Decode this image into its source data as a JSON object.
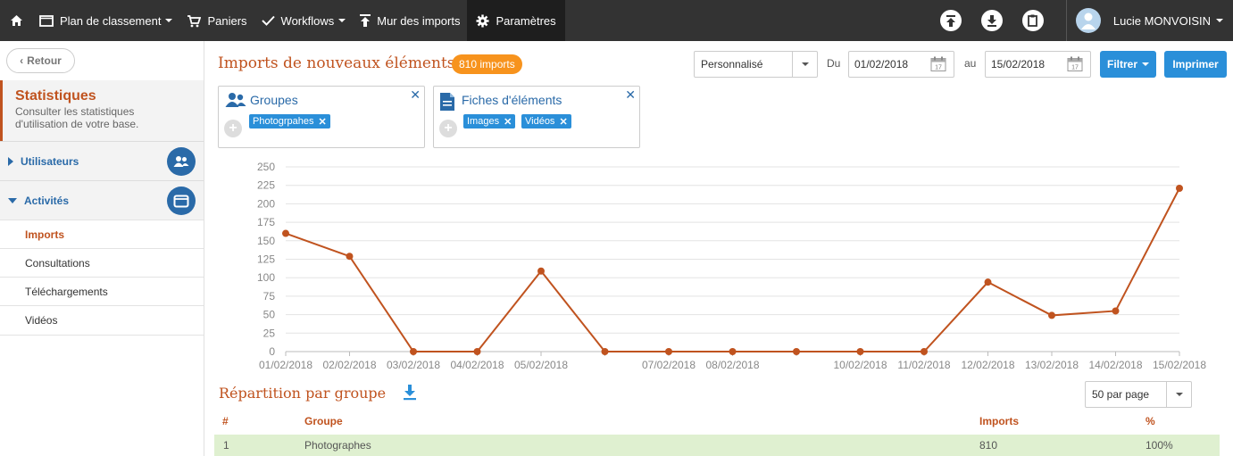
{
  "topbar": {
    "home_icon": "home-icon",
    "items": [
      {
        "label": "Plan de classement",
        "icon": "folder-icon"
      },
      {
        "label": "Paniers",
        "icon": "cart-icon"
      },
      {
        "label": "Workflows",
        "icon": "check-icon"
      },
      {
        "label": "Mur des imports",
        "icon": "upload-icon"
      },
      {
        "label": "Paramètres",
        "icon": "gear-icon"
      }
    ],
    "user_name": "Lucie MONVOISIN"
  },
  "sidebar": {
    "back_label": "Retour",
    "stats_title": "Statistiques",
    "stats_desc": "Consulter les statistiques d'utilisation de votre base.",
    "sections": [
      {
        "label": "Utilisateurs"
      },
      {
        "label": "Activités"
      }
    ],
    "sub_items": [
      "Imports",
      "Consultations",
      "Téléchargements",
      "Vidéos"
    ]
  },
  "main": {
    "title": "Imports de nouveaux éléments",
    "count_badge": "810 imports",
    "period_select": "Personnalisé",
    "from_label": "Du",
    "from_date": "01/02/2018",
    "to_label": "au",
    "to_date": "15/02/2018",
    "filter_button": "Filtrer",
    "print_button": "Imprimer",
    "filters": [
      {
        "title": "Groupes",
        "tags": [
          "Photogrpahes"
        ]
      },
      {
        "title": "Fiches d'éléments",
        "tags": [
          "Images",
          "Vidéos"
        ]
      }
    ]
  },
  "chart_data": {
    "type": "line",
    "x": [
      "01/02/2018",
      "02/02/2018",
      "03/02/2018",
      "04/02/2018",
      "05/02/2018",
      "06/02/2018",
      "07/02/2018",
      "08/02/2018",
      "09/02/2018",
      "10/02/2018",
      "11/02/2018",
      "12/02/2018",
      "13/02/2018",
      "14/02/2018",
      "15/02/2018"
    ],
    "x_tick_labels": [
      "01/02/2018",
      "02/02/2018",
      "03/02/2018",
      "04/02/2018",
      "05/02/2018",
      "",
      "07/02/2018",
      "08/02/2018",
      "",
      "10/02/2018",
      "11/02/2018",
      "12/02/2018",
      "13/02/2018",
      "14/02/2018",
      "15/02/2018"
    ],
    "series": [
      {
        "values": [
          160,
          129,
          0,
          0,
          109,
          0,
          0,
          0,
          0,
          0,
          0,
          94,
          49,
          55,
          221
        ],
        "color": "#c0531f"
      }
    ],
    "ylim": [
      0,
      250
    ],
    "yticks": [
      0,
      25,
      50,
      75,
      100,
      125,
      150,
      175,
      200,
      225,
      250
    ],
    "grid": true
  },
  "repartition": {
    "title": "Répartition par groupe",
    "per_page": "50 par page",
    "columns": [
      "#",
      "Groupe",
      "Imports",
      "%"
    ],
    "rows": [
      {
        "num": "1",
        "group": "Photographes",
        "imports": "810",
        "pct": "100%"
      }
    ]
  },
  "colors": {
    "accent": "#c0531f",
    "blue": "#2a8fd9",
    "badge": "#f7931d",
    "topbar": "#333333"
  }
}
